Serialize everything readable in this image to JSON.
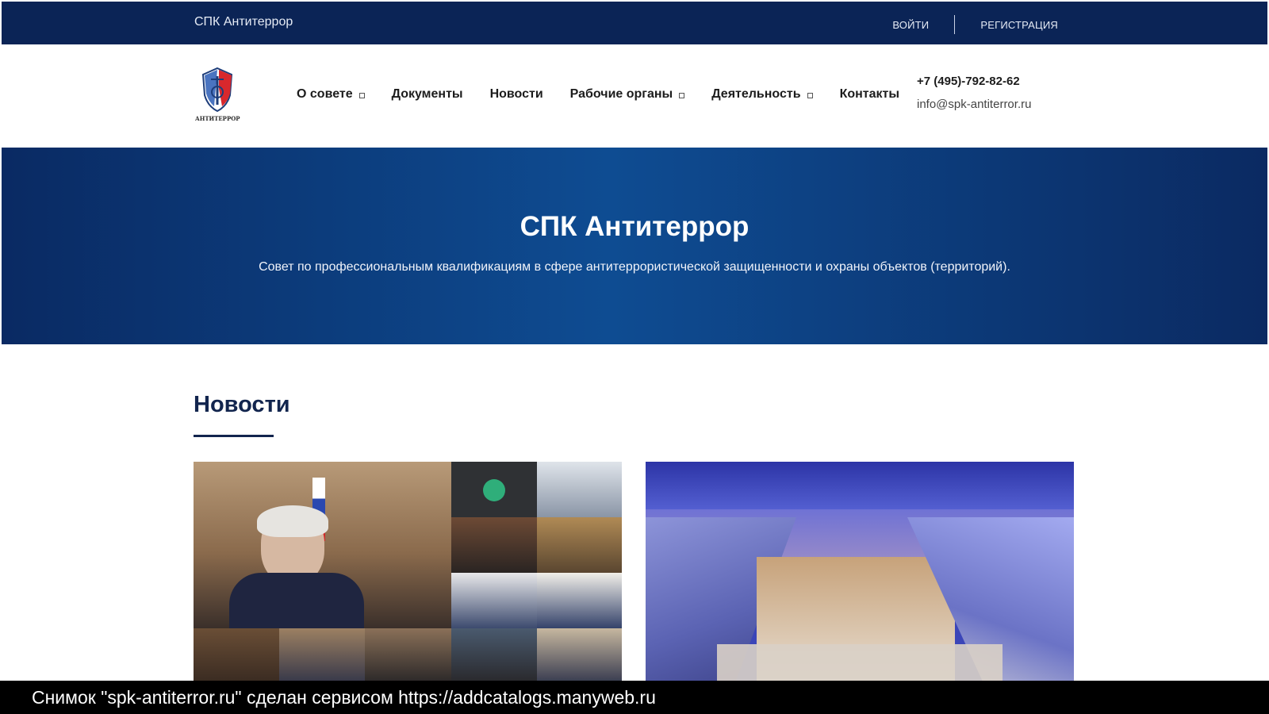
{
  "topbar": {
    "brand": "СПК Антитеррор",
    "login": "ВОЙТИ",
    "register": "РЕГИСТРАЦИЯ"
  },
  "header": {
    "logo_text": "АНТИТЕРРОР",
    "nav": [
      {
        "label": "О совете",
        "has_dropdown": true
      },
      {
        "label": "Документы",
        "has_dropdown": false
      },
      {
        "label": "Новости",
        "has_dropdown": false
      },
      {
        "label": "Рабочие органы",
        "has_dropdown": true
      },
      {
        "label": "Деятельность",
        "has_dropdown": true
      },
      {
        "label": "Контакты",
        "has_dropdown": false
      }
    ],
    "phone": "+7 (495)-792-82-62",
    "email": "info@spk-antiterror.ru"
  },
  "hero": {
    "title": "СПК Антитеррор",
    "subtitle": "Совет по профессиональным квалификациям в сфере антитеррористической защищенности и охраны объектов (территорий)."
  },
  "news": {
    "title": "Новости",
    "cards": [
      {
        "image": "video-conference-photo"
      },
      {
        "image": "shopping-mall-photo"
      }
    ]
  },
  "footer": {
    "caption": "Снимок \"spk-antiterror.ru\" сделан сервисом https://addcatalogs.manyweb.ru"
  },
  "colors": {
    "topbar": "#0b2456",
    "hero_dark": "#0a2a63",
    "hero_mid": "#0e4c92",
    "heading": "#12254e"
  }
}
